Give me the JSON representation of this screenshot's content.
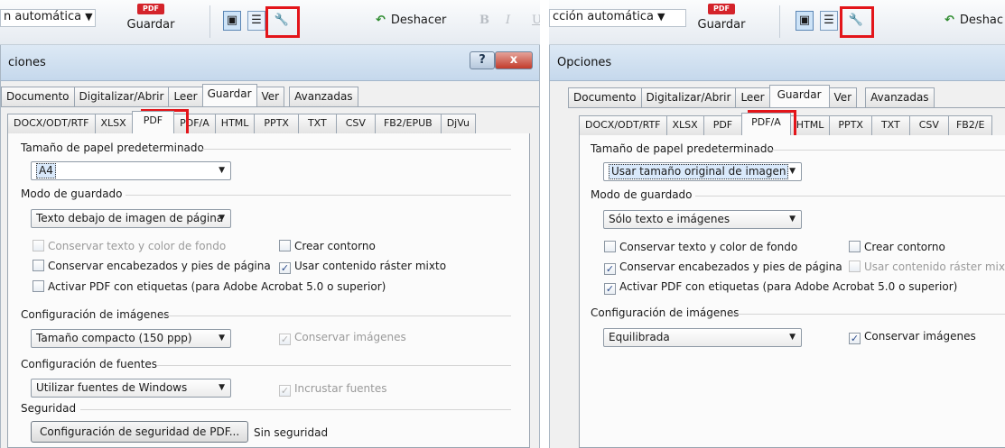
{
  "accent_color": "#e3151a",
  "left": {
    "toolbar": {
      "combo_text": "n automática",
      "save_label": "Guardar",
      "pdf_badge": "PDF",
      "undo_label": "Deshacer",
      "bold_label": "B",
      "italic_label": "I",
      "underline_label": "U",
      "icons": [
        "image-view-icon",
        "text-view-icon",
        "options-wrench-icon"
      ]
    },
    "window": {
      "title": "ciones",
      "help_label": "?",
      "close_label": "x"
    },
    "main_tabs": [
      "Documento",
      "Digitalizar/Abrir",
      "Leer",
      "Guardar",
      "Ver",
      "Avanzadas"
    ],
    "main_tab_selected": "Guardar",
    "format_tabs": [
      "DOCX/ODT/RTF",
      "XLSX",
      "PDF",
      "PDF/A",
      "HTML",
      "PPTX",
      "TXT",
      "CSV",
      "FB2/EPUB",
      "DjVu"
    ],
    "format_tab_selected": "PDF",
    "paper": {
      "heading": "Tamaño de papel predeterminado",
      "value": "A4"
    },
    "save_mode": {
      "heading": "Modo de guardado",
      "value": "Texto debajo de imagen de página"
    },
    "checks": {
      "keep_text_bg": "Conservar texto y color de fondo",
      "create_outline": "Crear contorno",
      "keep_headers": "Conservar encabezados y pies de página",
      "mixed_raster": "Usar contenido ráster mixto",
      "tagged_pdf": "Activar PDF con etiquetas (para Adobe Acrobat 5.0 o superior)"
    },
    "images": {
      "heading": "Configuración de imágenes",
      "value": "Tamaño compacto (150 ppp)",
      "keep_images": "Conservar imágenes"
    },
    "fonts": {
      "heading": "Configuración de fuentes",
      "value": "Utilizar fuentes de Windows",
      "embed_fonts": "Incrustar fuentes"
    },
    "security": {
      "heading": "Seguridad",
      "button": "Configuración de seguridad de PDF...",
      "status": "Sin seguridad"
    }
  },
  "right": {
    "toolbar": {
      "combo_text": "cción automática",
      "save_label": "Guardar",
      "pdf_badge": "PDF",
      "undo_label": "Deshac",
      "icons": [
        "image-view-icon",
        "text-view-icon",
        "options-wrench-icon"
      ]
    },
    "window": {
      "title": "Opciones"
    },
    "main_tabs": [
      "Documento",
      "Digitalizar/Abrir",
      "Leer",
      "Guardar",
      "Ver",
      "Avanzadas"
    ],
    "main_tab_selected": "Guardar",
    "format_tabs": [
      "DOCX/ODT/RTF",
      "XLSX",
      "PDF",
      "PDF/A",
      "HTML",
      "PPTX",
      "TXT",
      "CSV",
      "FB2/E"
    ],
    "format_tab_selected": "PDF/A",
    "paper": {
      "heading": "Tamaño de papel predeterminado",
      "value": "Usar tamaño original de imagen"
    },
    "save_mode": {
      "heading": "Modo de guardado",
      "value": "Sólo texto e imágenes"
    },
    "checks": {
      "keep_text_bg": "Conservar texto y color de fondo",
      "create_outline": "Crear contorno",
      "keep_headers": "Conservar encabezados y pies de página",
      "mixed_raster": "Usar contenido ráster mixto",
      "tagged_pdf": "Activar PDF con etiquetas (para Adobe Acrobat 5.0 o superior)"
    },
    "images": {
      "heading": "Configuración de imágenes",
      "value": "Equilibrada",
      "keep_images": "Conservar imágenes"
    }
  }
}
